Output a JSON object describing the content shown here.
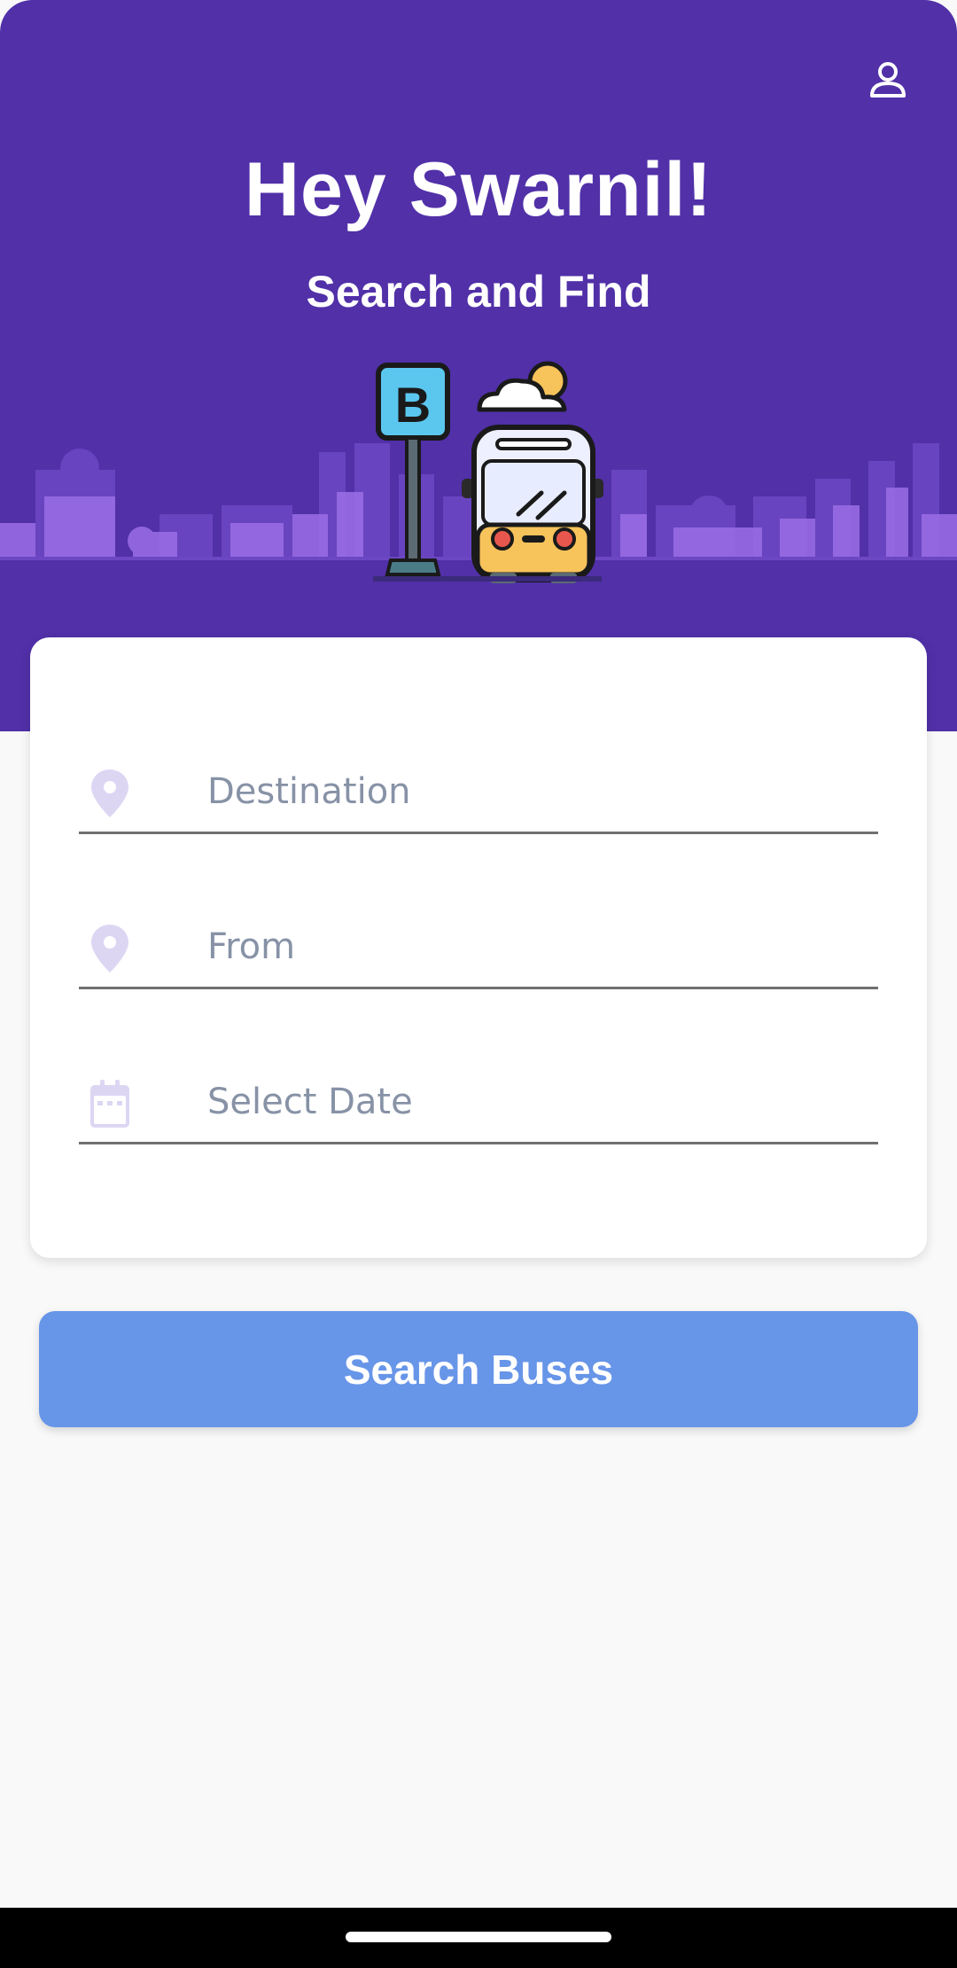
{
  "header": {
    "greeting": "Hey Swarnil!",
    "subtitle": "Search and Find",
    "profile_icon": "user-icon",
    "background_color": "#5130a8"
  },
  "illustration": {
    "sign_letter": "B"
  },
  "form": {
    "destination": {
      "placeholder": "Destination",
      "icon": "location-pin-icon"
    },
    "from": {
      "placeholder": "From",
      "icon": "location-pin-icon"
    },
    "date": {
      "placeholder": "Select Date",
      "icon": "calendar-icon"
    }
  },
  "search_button": {
    "label": "Search Buses",
    "color": "#6795e8"
  },
  "colors": {
    "accent": "#5130a8",
    "icon_tint": "#ddd6f3",
    "placeholder": "#8792a6"
  }
}
